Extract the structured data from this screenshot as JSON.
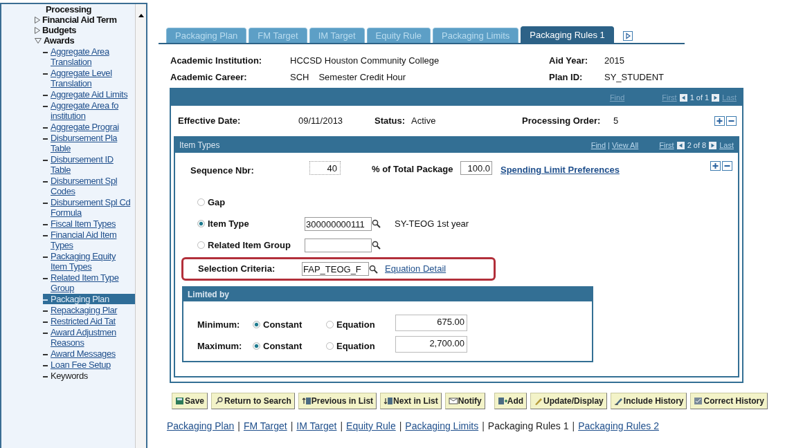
{
  "sidebar": {
    "items": [
      {
        "label": "Processing"
      },
      {
        "label": "Financial Aid Term",
        "expanded": false
      },
      {
        "label": "Budgets",
        "expanded": false
      },
      {
        "label": "Awards",
        "expanded": true,
        "children": [
          {
            "label": "Aggregate Area Translation",
            "selected": false,
            "link": true
          },
          {
            "label": "Aggregate Level Translation",
            "selected": false,
            "link": true
          },
          {
            "label": "Aggregate Aid Limits",
            "selected": false,
            "link": true
          },
          {
            "label": "Aggregate Area fo institution",
            "selected": false,
            "link": true
          },
          {
            "label": "Aggregate Prograi",
            "selected": false,
            "link": true
          },
          {
            "label": "Disbursement Pla Table",
            "selected": false,
            "link": true
          },
          {
            "label": "Disbursement ID Table",
            "selected": false,
            "link": true
          },
          {
            "label": "Disbursement Spl Codes",
            "selected": false,
            "link": true
          },
          {
            "label": "Disbursement Spl Cd Formula",
            "selected": false,
            "link": true
          },
          {
            "label": "Fiscal Item Types",
            "selected": false,
            "link": true
          },
          {
            "label": "Financial Aid Item Types",
            "selected": false,
            "link": true
          },
          {
            "label": "Packaging Equity Item Types",
            "selected": false,
            "link": true
          },
          {
            "label": "Related Item Type Group",
            "selected": false,
            "link": true
          },
          {
            "label": "Packaging Plan",
            "selected": true,
            "link": false
          },
          {
            "label": "Repackaging Plar",
            "selected": false,
            "link": true
          },
          {
            "label": "Restricted Aid Tat",
            "selected": false,
            "link": true
          },
          {
            "label": "Award Adjustmen Reasons",
            "selected": false,
            "link": true
          },
          {
            "label": "Award Messages",
            "selected": false,
            "link": true
          },
          {
            "label": "Loan Fee Setup",
            "selected": false,
            "link": true
          },
          {
            "label": "Keywords",
            "selected": false,
            "link": false
          }
        ]
      }
    ]
  },
  "tabs": [
    {
      "label": "Packaging Plan",
      "selected": false
    },
    {
      "label": "FM Target",
      "selected": false
    },
    {
      "label": "IM Target",
      "selected": false
    },
    {
      "label": "Equity Rule",
      "selected": false
    },
    {
      "label": "Packaging Limits",
      "selected": false
    },
    {
      "label": "Packaging Rules 1",
      "selected": true
    }
  ],
  "header": {
    "left": [
      {
        "label": "Academic Institution:",
        "values": [
          "HCCSD Houston Community College"
        ]
      },
      {
        "label": "Academic Career:",
        "values": [
          "SCH",
          "Semester Credit Hour"
        ]
      }
    ],
    "right": [
      {
        "label": "Aid Year:",
        "value": "2015"
      },
      {
        "label": "Plan ID:",
        "value": "SY_STUDENT"
      }
    ]
  },
  "rules_panel": {
    "nav": {
      "find": "Find",
      "first": "First",
      "count": "1 of 1",
      "last": "Last"
    },
    "effective_date": {
      "label": "Effective Date:",
      "value": "09/11/2013"
    },
    "status": {
      "label": "Status:",
      "value": "Active"
    },
    "processing_order": {
      "label": "Processing Order:",
      "value": "5"
    }
  },
  "item_types": {
    "title": "Item Types",
    "nav": {
      "find": "Find",
      "separator": "|",
      "view_all": "View All",
      "first": "First",
      "count": "2 of 8",
      "last": "Last"
    },
    "sequence_nbr": {
      "label": "Sequence Nbr:",
      "value": "40"
    },
    "percent_total": {
      "label": "% of Total Package",
      "value": "100.0"
    },
    "spending_link": "Spending Limit Preferences",
    "options": [
      {
        "label": "Gap",
        "selected": false,
        "kind": "plain"
      },
      {
        "label": "Item Type",
        "selected": true,
        "kind": "field",
        "value": "300000000111",
        "description": "SY-TEOG 1st year"
      },
      {
        "label": "Related Item Group",
        "selected": false,
        "kind": "field"
      }
    ],
    "selection_criteria": {
      "label": "Selection Criteria:",
      "value": "FAP_TEOG_F",
      "link": "Equation Detail",
      "highlighted": true
    },
    "limited_by": {
      "title": "Limited by",
      "rows": [
        {
          "label": "Minimum:",
          "options": [
            {
              "label": "Constant",
              "selected": true
            },
            {
              "label": "Equation",
              "selected": false
            }
          ],
          "value": "675.00"
        },
        {
          "label": "Maximum:",
          "options": [
            {
              "label": "Constant",
              "selected": true
            },
            {
              "label": "Equation",
              "selected": false
            }
          ],
          "value": "2,700.00"
        }
      ]
    }
  },
  "buttons": [
    {
      "label": "Save",
      "kind": "save"
    },
    {
      "label": "Return to Search",
      "kind": "search"
    },
    {
      "label": "Previous in List",
      "kind": "prev"
    },
    {
      "label": "Next in List",
      "kind": "next"
    },
    {
      "label": "Notify",
      "kind": "notify"
    },
    {
      "label": "Add",
      "kind": "add"
    },
    {
      "label": "Update/Display",
      "kind": "update"
    },
    {
      "label": "Include History",
      "kind": "include"
    },
    {
      "label": "Correct History",
      "kind": "correct"
    }
  ],
  "footer_links": [
    {
      "kind": "link",
      "label": "Packaging Plan",
      "selected": false
    },
    {
      "kind": "separator",
      "label": "|"
    },
    {
      "kind": "link",
      "label": "FM Target",
      "selected": false
    },
    {
      "kind": "separator",
      "label": "|"
    },
    {
      "kind": "link",
      "label": "IM Target",
      "selected": false
    },
    {
      "kind": "separator",
      "label": "|"
    },
    {
      "kind": "link",
      "label": "Equity Rule",
      "selected": false
    },
    {
      "kind": "separator",
      "label": "|"
    },
    {
      "kind": "link",
      "label": "Packaging Limits",
      "selected": false
    },
    {
      "kind": "separator",
      "label": "|"
    },
    {
      "kind": "link",
      "label": "Packaging Rules 1",
      "selected": true
    },
    {
      "kind": "separator",
      "label": "|"
    },
    {
      "kind": "link",
      "label": "Packaging Rules 2",
      "selected": false
    }
  ]
}
